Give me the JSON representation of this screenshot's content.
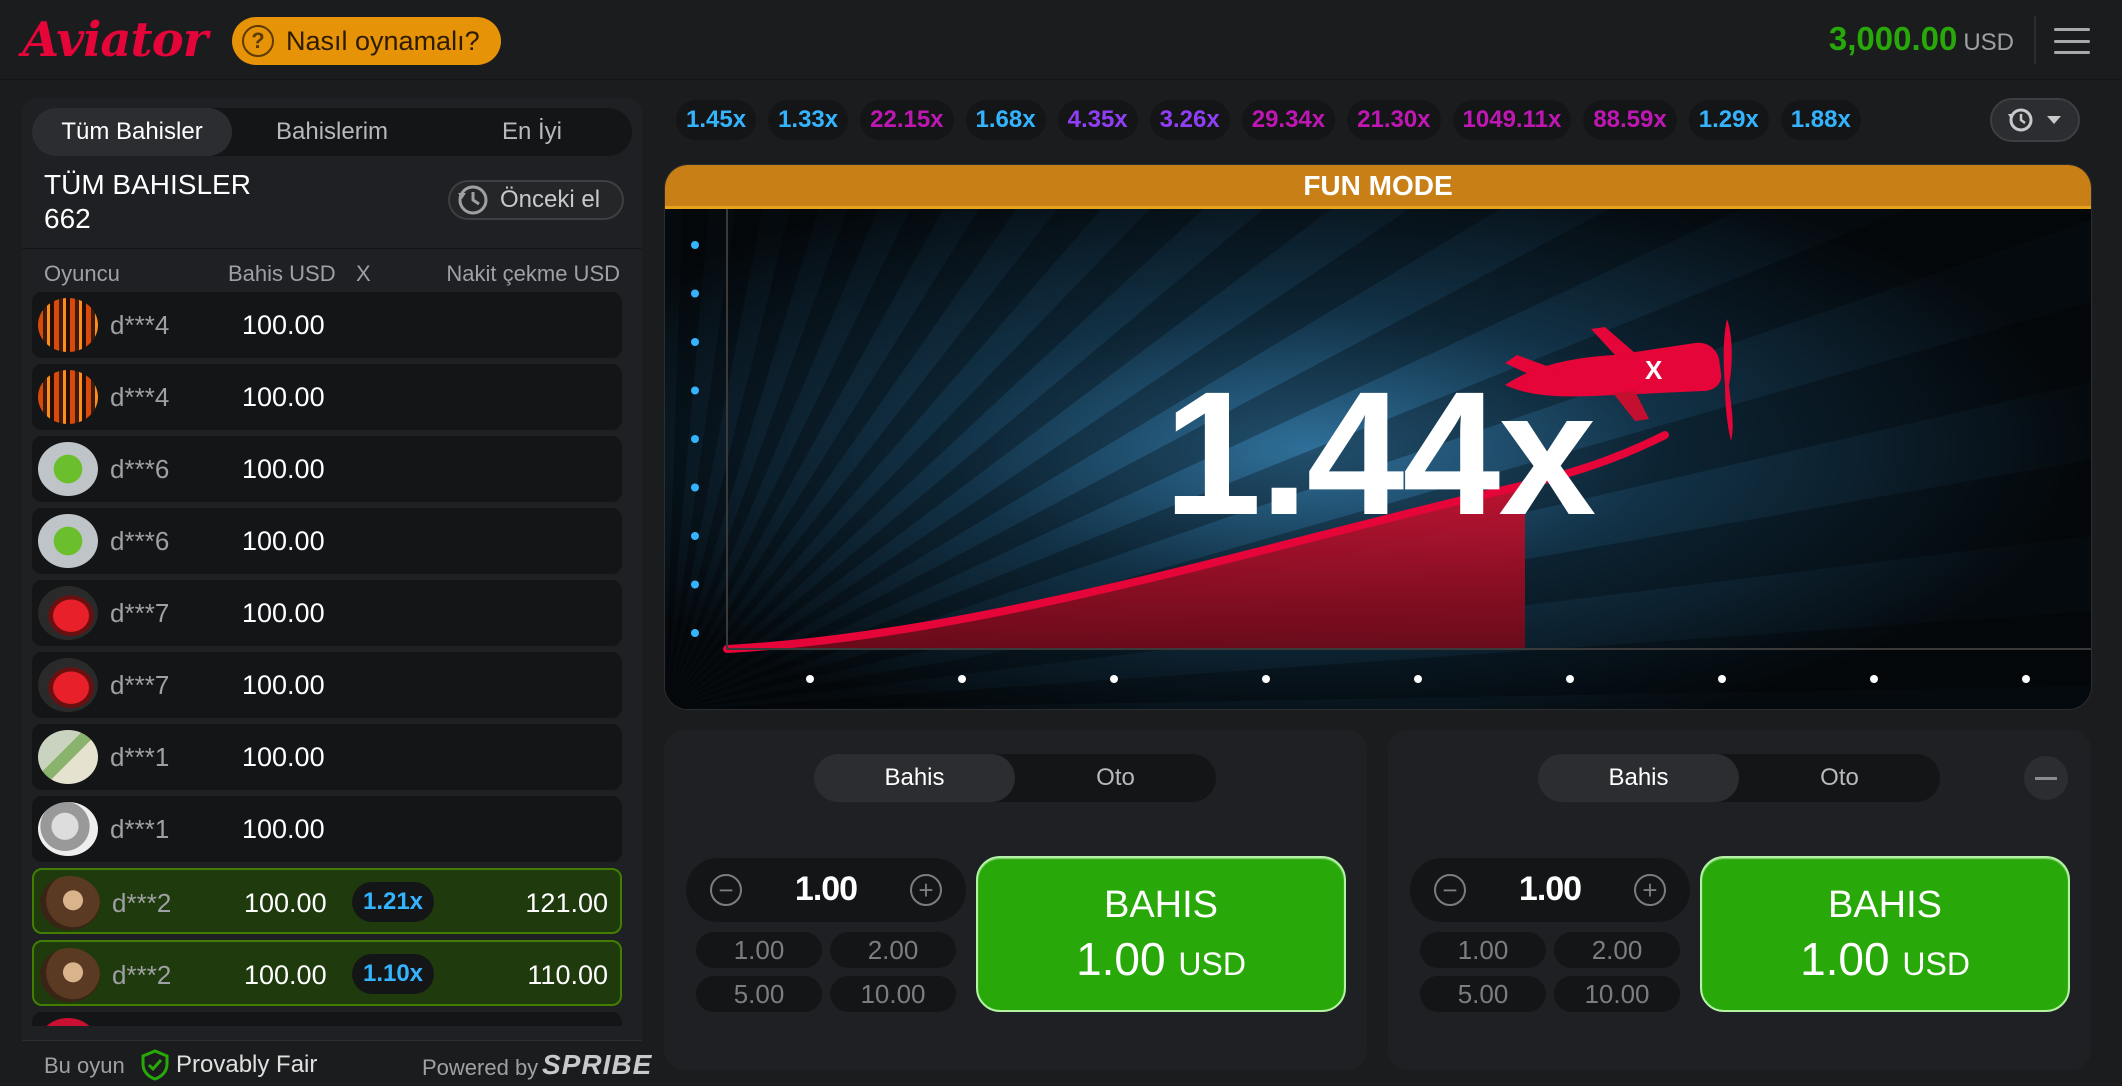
{
  "header": {
    "logo": "Aviator",
    "how_to_play": "Nasıl oynamalı?",
    "balance": "3,000.00",
    "currency": "USD"
  },
  "bets_panel": {
    "tabs": [
      {
        "label": "Tüm Bahisler",
        "active": true
      },
      {
        "label": "Bahislerim",
        "active": false
      },
      {
        "label": "En İyi",
        "active": false
      }
    ],
    "title": "TÜM BAHISLER",
    "count": "662",
    "prev_round": "Önceki el",
    "columns": {
      "player": "Oyuncu",
      "bet": "Bahis USD",
      "x": "X",
      "cashout": "Nakit çekme USD"
    },
    "rows": [
      {
        "name": "d***4",
        "bet": "100.00",
        "mult": "",
        "cashout": "",
        "avatar": "forest",
        "win": false
      },
      {
        "name": "d***4",
        "bet": "100.00",
        "mult": "",
        "cashout": "",
        "avatar": "forest",
        "win": false
      },
      {
        "name": "d***6",
        "bet": "100.00",
        "mult": "",
        "cashout": "",
        "avatar": "clover",
        "win": false
      },
      {
        "name": "d***6",
        "bet": "100.00",
        "mult": "",
        "cashout": "",
        "avatar": "clover",
        "win": false
      },
      {
        "name": "d***7",
        "bet": "100.00",
        "mult": "",
        "cashout": "",
        "avatar": "car",
        "win": false
      },
      {
        "name": "d***7",
        "bet": "100.00",
        "mult": "",
        "cashout": "",
        "avatar": "car",
        "win": false
      },
      {
        "name": "d***1",
        "bet": "100.00",
        "mult": "",
        "cashout": "",
        "avatar": "map",
        "win": false
      },
      {
        "name": "d***1",
        "bet": "100.00",
        "mult": "",
        "cashout": "",
        "avatar": "bird",
        "win": false
      },
      {
        "name": "d***2",
        "bet": "100.00",
        "mult": "1.21x",
        "cashout": "121.00",
        "avatar": "hair",
        "win": true
      },
      {
        "name": "d***2",
        "bet": "100.00",
        "mult": "1.10x",
        "cashout": "110.00",
        "avatar": "hair",
        "win": true
      }
    ],
    "footer": {
      "provably_prefix": "Bu oyun",
      "provably": "Provably Fair",
      "powered": "Powered by",
      "brand": "SPRIBE"
    }
  },
  "history": [
    {
      "value": "1.45x",
      "color": "#34b4ff"
    },
    {
      "value": "1.33x",
      "color": "#34b4ff"
    },
    {
      "value": "22.15x",
      "color": "#c017b4"
    },
    {
      "value": "1.68x",
      "color": "#34b4ff"
    },
    {
      "value": "4.35x",
      "color": "#913ef8"
    },
    {
      "value": "3.26x",
      "color": "#913ef8"
    },
    {
      "value": "29.34x",
      "color": "#c017b4"
    },
    {
      "value": "21.30x",
      "color": "#c017b4"
    },
    {
      "value": "1049.11x",
      "color": "#c017b4"
    },
    {
      "value": "88.59x",
      "color": "#c017b4"
    },
    {
      "value": "1.29x",
      "color": "#34b4ff"
    },
    {
      "value": "1.88x",
      "color": "#34b4ff"
    }
  ],
  "game": {
    "fun_mode": "FUN MODE",
    "multiplier": "1.44x"
  },
  "bet_controls": [
    {
      "tabs": [
        {
          "label": "Bahis",
          "active": true
        },
        {
          "label": "Oto",
          "active": false
        }
      ],
      "amount": "1.00",
      "quick": [
        "1.00",
        "2.00",
        "5.00",
        "10.00"
      ],
      "button_label": "BAHIS",
      "button_amount": "1.00",
      "button_currency": "USD"
    },
    {
      "tabs": [
        {
          "label": "Bahis",
          "active": true
        },
        {
          "label": "Oto",
          "active": false
        }
      ],
      "amount": "1.00",
      "quick": [
        "1.00",
        "2.00",
        "5.00",
        "10.00"
      ],
      "button_label": "BAHIS",
      "button_amount": "1.00",
      "button_currency": "USD"
    }
  ]
}
